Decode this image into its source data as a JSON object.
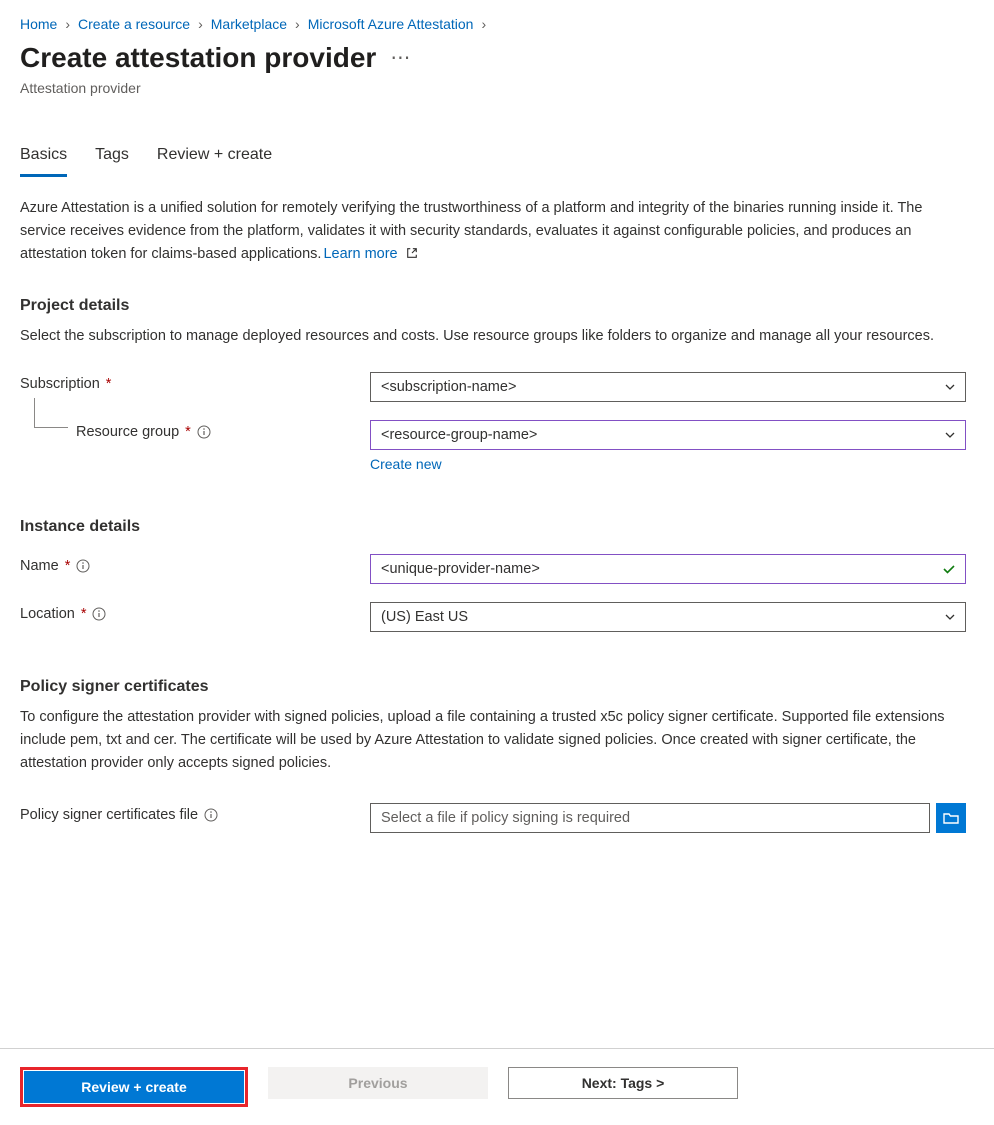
{
  "breadcrumb": {
    "items": [
      "Home",
      "Create a resource",
      "Marketplace",
      "Microsoft Azure Attestation"
    ]
  },
  "header": {
    "title": "Create attestation provider",
    "subtitle": "Attestation provider"
  },
  "tabs": {
    "items": [
      "Basics",
      "Tags",
      "Review + create"
    ],
    "active": 0
  },
  "intro": {
    "text": "Azure Attestation is a unified solution for remotely verifying the trustworthiness of a platform and integrity of the binaries running inside it. The service receives evidence from the platform, validates it with security standards, evaluates it against configurable policies, and produces an attestation token for claims-based applications.",
    "learn_more": "Learn more"
  },
  "project": {
    "title": "Project details",
    "desc": "Select the subscription to manage deployed resources and costs. Use resource groups like folders to organize and manage all your resources.",
    "subscription_label": "Subscription",
    "subscription_value": "<subscription-name>",
    "resource_group_label": "Resource group",
    "resource_group_value": "<resource-group-name>",
    "create_new": "Create new"
  },
  "instance": {
    "title": "Instance details",
    "name_label": "Name",
    "name_value": "<unique-provider-name>",
    "location_label": "Location",
    "location_value": "(US) East US"
  },
  "policy": {
    "title": "Policy signer certificates",
    "desc": "To configure the attestation provider with signed policies, upload a file containing a trusted x5c policy signer certificate. Supported file extensions include pem, txt and cer. The certificate will be used by Azure Attestation to validate signed policies. Once created with signer certificate, the attestation provider only accepts signed policies.",
    "file_label": "Policy signer certificates file",
    "file_placeholder": "Select a file if policy signing is required"
  },
  "footer": {
    "review_create": "Review + create",
    "previous": "Previous",
    "next": "Next: Tags >"
  }
}
